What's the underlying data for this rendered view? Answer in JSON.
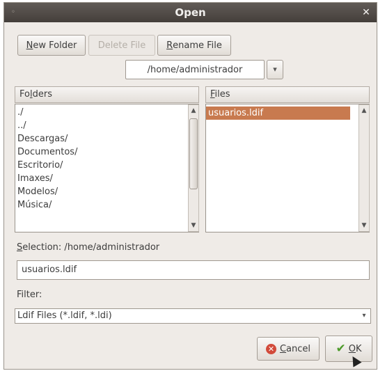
{
  "window": {
    "title": "Open",
    "close_glyph": "✕"
  },
  "toolbar": {
    "new_folder": {
      "prefix": "",
      "mnemonic": "N",
      "rest": "ew Folder"
    },
    "delete_file": "Delete File",
    "rename_file": {
      "mnemonic": "R",
      "rest": "ename File"
    }
  },
  "path": {
    "value": "/home/administrador"
  },
  "folders": {
    "header_mnemonic": "l",
    "header_pre": "Fo",
    "header_post": "ders",
    "items": [
      "./",
      "../",
      "Descargas/",
      "Documentos/",
      "Escritorio/",
      "Imaxes/",
      "Modelos/",
      "Música/"
    ]
  },
  "files": {
    "header_mnemonic": "F",
    "header_rest": "iles",
    "items": [
      "usuarios.ldif"
    ],
    "selected": "usuarios.ldif"
  },
  "selection": {
    "mnemonic": "S",
    "label_rest": "election: /home/administrador",
    "value": "usuarios.ldif"
  },
  "filter": {
    "label": "Filter:",
    "value": "Ldif Files (*.ldif, *.ldi)"
  },
  "buttons": {
    "cancel": {
      "mnemonic": "C",
      "rest": "ancel"
    },
    "ok": {
      "mnemonic": "O",
      "rest": "K"
    }
  },
  "icons": {
    "cancel": "cancel-icon",
    "ok": "checkmark-icon",
    "close": "close-icon",
    "dropdown": "chevron-down-icon"
  }
}
